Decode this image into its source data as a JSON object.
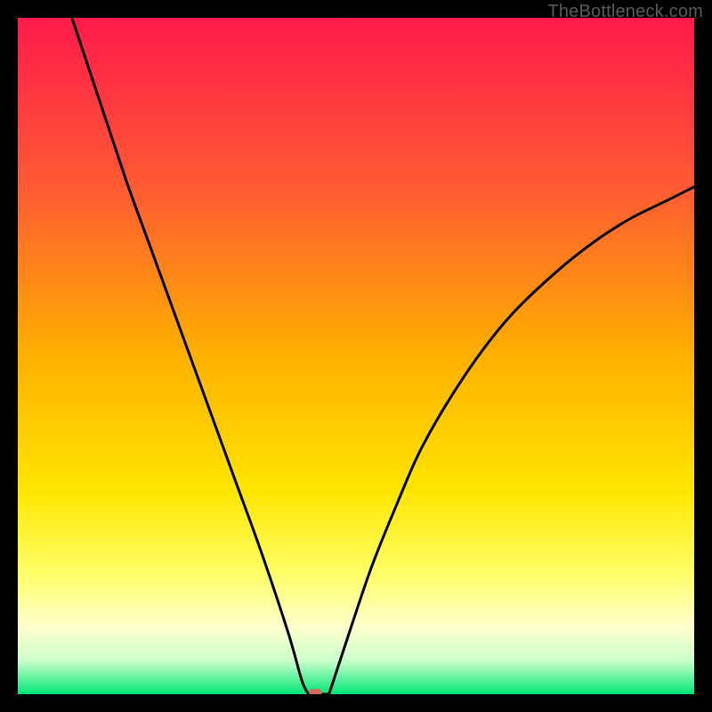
{
  "watermark": "TheBottleneck.com",
  "colors": {
    "frame": "#000000",
    "line": "#000000",
    "dot": "#d26a5c",
    "gradient_stops": [
      {
        "offset": 0.0,
        "color": "#ff1a4b"
      },
      {
        "offset": 0.25,
        "color": "#ff5a33"
      },
      {
        "offset": 0.5,
        "color": "#ffb000"
      },
      {
        "offset": 0.7,
        "color": "#ffe600"
      },
      {
        "offset": 0.82,
        "color": "#ffff66"
      },
      {
        "offset": 0.9,
        "color": "#ffffcc"
      },
      {
        "offset": 0.95,
        "color": "#ccffcc"
      },
      {
        "offset": 1.0,
        "color": "#00e676"
      }
    ]
  },
  "chart_data": {
    "type": "line",
    "title": "",
    "xlabel": "",
    "ylabel": "",
    "xlim": [
      0,
      100
    ],
    "ylim": [
      0,
      100
    ],
    "min_marker": {
      "x": 44,
      "y": 0
    },
    "left_branch": [
      {
        "x": 8,
        "y": 100
      },
      {
        "x": 12,
        "y": 88
      },
      {
        "x": 16,
        "y": 76
      },
      {
        "x": 20,
        "y": 65
      },
      {
        "x": 24,
        "y": 54
      },
      {
        "x": 28,
        "y": 43
      },
      {
        "x": 32,
        "y": 32
      },
      {
        "x": 36,
        "y": 21
      },
      {
        "x": 40,
        "y": 9
      },
      {
        "x": 42,
        "y": 2
      },
      {
        "x": 43,
        "y": 0
      }
    ],
    "flat": [
      {
        "x": 43,
        "y": 0
      },
      {
        "x": 46,
        "y": 0
      }
    ],
    "right_branch": [
      {
        "x": 46,
        "y": 0
      },
      {
        "x": 48,
        "y": 6
      },
      {
        "x": 52,
        "y": 18
      },
      {
        "x": 56,
        "y": 28
      },
      {
        "x": 60,
        "y": 37
      },
      {
        "x": 66,
        "y": 47
      },
      {
        "x": 72,
        "y": 55
      },
      {
        "x": 78,
        "y": 61
      },
      {
        "x": 84,
        "y": 66
      },
      {
        "x": 90,
        "y": 70
      },
      {
        "x": 96,
        "y": 73
      },
      {
        "x": 100,
        "y": 75
      }
    ]
  }
}
